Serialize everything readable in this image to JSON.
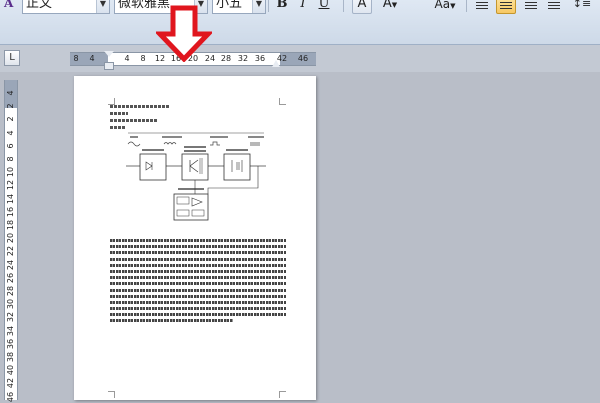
{
  "toolbar": {
    "style_combo": "正文",
    "font_combo": "微软雅黑",
    "size_combo": "小五",
    "bold": "B",
    "italic": "I",
    "underline": "U",
    "char_border": "A",
    "text_effect": "A",
    "change_case": "Aa"
  },
  "ruler": {
    "tab_selector": "L",
    "horizontal_ticks": [
      "8",
      "4",
      "4",
      "8",
      "12",
      "16",
      "20",
      "24",
      "28",
      "32",
      "36",
      "42",
      "46"
    ],
    "vertical_ticks": [
      "4",
      "2",
      "2",
      "4",
      "6",
      "8",
      "10",
      "12",
      "14",
      "16",
      "18",
      "20",
      "22",
      "24",
      "26",
      "28",
      "30",
      "32",
      "34",
      "36",
      "38",
      "40",
      "42",
      "46"
    ]
  },
  "colors": {
    "annotation_arrow": "#e0161e",
    "ribbon": "#dfe8f3",
    "workspace": "#b9bec8"
  }
}
